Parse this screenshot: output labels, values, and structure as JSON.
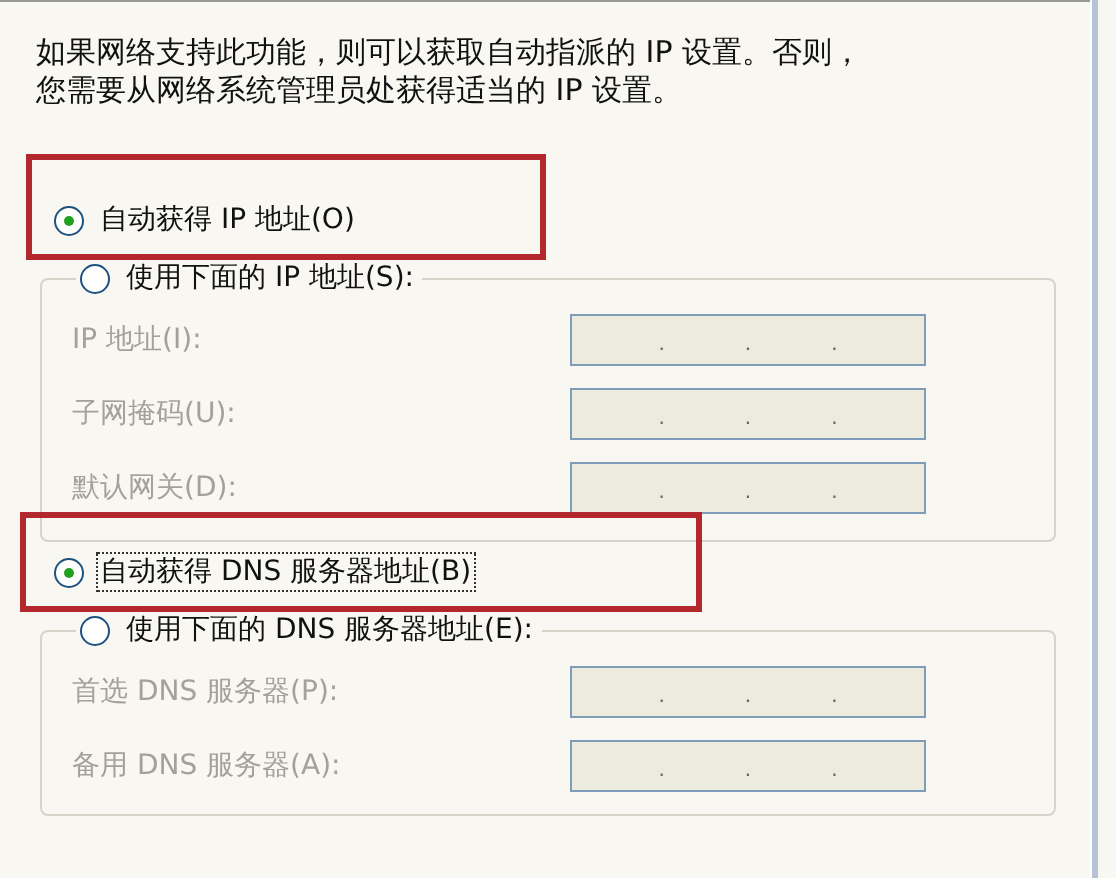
{
  "description": [
    "如果网络支持此功能，则可以获取自动指派的 IP 设置。否则，",
    "您需要从网络系统管理员处获得适当的 IP 设置。"
  ],
  "sections": [
    {
      "auto_option": {
        "label": "自动获得 IP 地址(O)",
        "selected": true,
        "focused": false,
        "highlighted": true
      },
      "manual_option": {
        "label": "使用下面的 IP 地址(S):",
        "selected": false
      },
      "fields": [
        {
          "label": "IP 地址(I):",
          "disabled": true,
          "separators": [
            ".",
            ".",
            "."
          ]
        },
        {
          "label": "子网掩码(U):",
          "disabled": true,
          "separators": [
            ".",
            ".",
            "."
          ]
        },
        {
          "label": "默认网关(D):",
          "disabled": true,
          "separators": [
            ".",
            ".",
            "."
          ]
        }
      ]
    },
    {
      "auto_option": {
        "label": "自动获得 DNS 服务器地址(B)",
        "selected": true,
        "focused": true,
        "highlighted": true
      },
      "manual_option": {
        "label": "使用下面的 DNS 服务器地址(E):",
        "selected": false
      },
      "fields": [
        {
          "label": "首选 DNS 服务器(P):",
          "disabled": true,
          "separators": [
            ".",
            ".",
            "."
          ]
        },
        {
          "label": "备用 DNS 服务器(A):",
          "disabled": true,
          "separators": [
            ".",
            ".",
            "."
          ]
        }
      ]
    }
  ]
}
